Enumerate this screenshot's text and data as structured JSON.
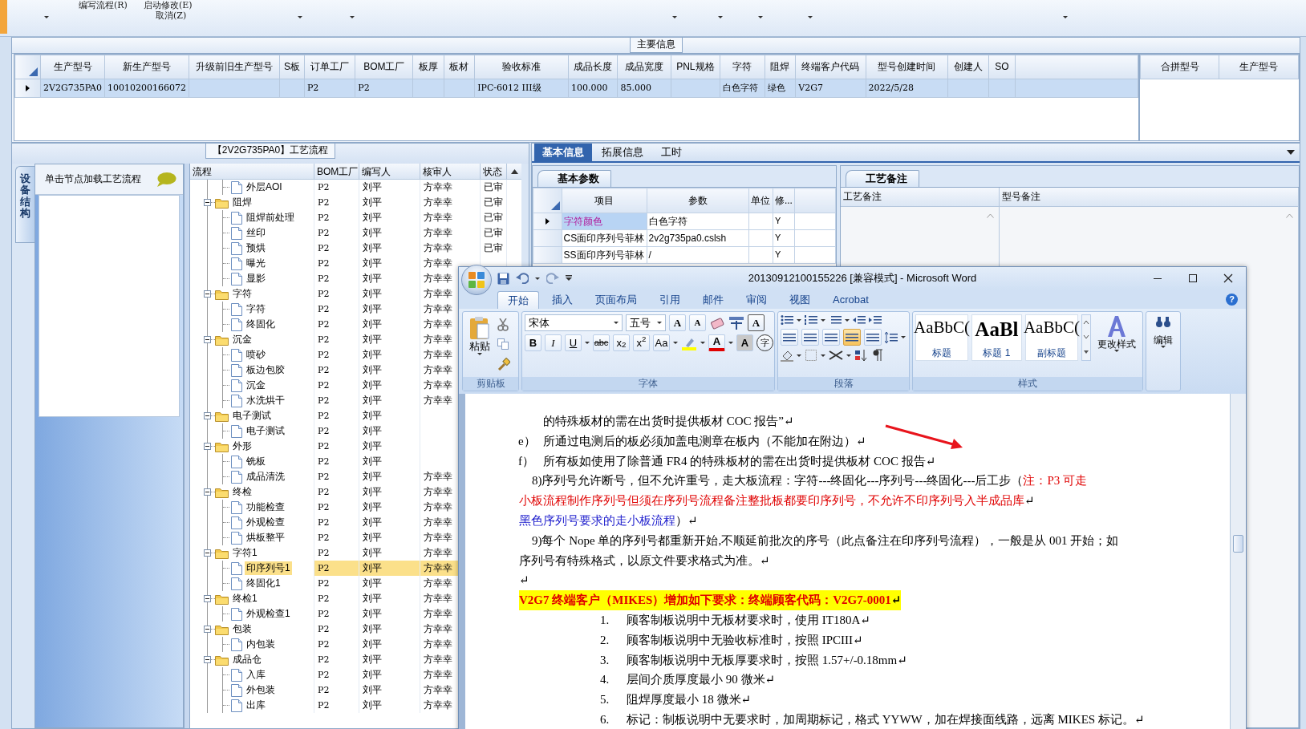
{
  "toolbar": {
    "menu_items": [
      {
        "label": "编写流程(R)"
      },
      {
        "label": "启动修改(E)"
      },
      {
        "label": "取消(Z)"
      }
    ]
  },
  "main_info": {
    "title": "主要信息",
    "row_selected": true,
    "columns": [
      {
        "label": "生产型号",
        "value": "2V2G735PA0"
      },
      {
        "label": "新生产型号",
        "value": "10010200166072"
      },
      {
        "label": "升级前旧生产型号"
      },
      {
        "label": "S板"
      },
      {
        "label": "订单工厂",
        "value": "P2"
      },
      {
        "label": "BOM工厂",
        "value": "P2"
      },
      {
        "label": "板厚"
      },
      {
        "label": "板材"
      },
      {
        "label": "验收标准",
        "value": "IPC-6012 III级"
      },
      {
        "label": "成品长度",
        "value": "100.000"
      },
      {
        "label": "成品宽度",
        "value": "85.000"
      },
      {
        "label": "PNL规格"
      },
      {
        "label": "字符",
        "value": "白色字符"
      },
      {
        "label": "阻焊",
        "value": "绿色"
      },
      {
        "label": "终端客户代码",
        "value": "V2G7"
      },
      {
        "label": "型号创建时间",
        "value": "2022/5/28"
      },
      {
        "label": "创建人"
      },
      {
        "label": "SO"
      }
    ],
    "side_columns": [
      "合拼型号",
      "生产型号"
    ]
  },
  "process": {
    "title": "【2V2G735PA0】工艺流程",
    "side_tab": "设备结构",
    "hint": "单击节点加载工艺流程",
    "columns": [
      "流程",
      "BOM工厂",
      "编写人",
      "核审人",
      "状态"
    ],
    "continued_children": [
      {
        "name": "外层AOI",
        "bom": "P2",
        "writer": "刘平",
        "reviewer": "方幸幸",
        "status": "已审",
        "selected": false
      }
    ],
    "nodes": [
      {
        "name": "阻焊",
        "bom": "P2",
        "writer": "刘平",
        "reviewer": "方幸幸",
        "status": "已审",
        "expanded": true,
        "selected": false,
        "children": [
          {
            "name": "阻焊前处理",
            "bom": "P2",
            "writer": "刘平",
            "reviewer": "方幸幸",
            "status": "已审",
            "selected": false
          },
          {
            "name": "丝印",
            "bom": "P2",
            "writer": "刘平",
            "reviewer": "方幸幸",
            "status": "已审",
            "selected": false
          },
          {
            "name": "预烘",
            "bom": "P2",
            "writer": "刘平",
            "reviewer": "方幸幸",
            "status": "已审",
            "selected": false
          },
          {
            "name": "曝光",
            "bom": "P2",
            "writer": "刘平",
            "reviewer": "方幸幸",
            "selected": false
          },
          {
            "name": "显影",
            "bom": "P2",
            "writer": "刘平",
            "reviewer": "方幸幸",
            "selected": false
          }
        ]
      },
      {
        "name": "字符",
        "bom": "P2",
        "writer": "刘平",
        "reviewer": "方幸幸",
        "expanded": true,
        "selected": false,
        "children": [
          {
            "name": "字符",
            "bom": "P2",
            "writer": "刘平",
            "reviewer": "方幸幸",
            "selected": false
          },
          {
            "name": "终固化",
            "bom": "P2",
            "writer": "刘平",
            "reviewer": "方幸幸",
            "selected": false
          }
        ]
      },
      {
        "name": "沉金",
        "bom": "P2",
        "writer": "刘平",
        "reviewer": "方幸幸",
        "expanded": true,
        "selected": false,
        "children": [
          {
            "name": "喷砂",
            "bom": "P2",
            "writer": "刘平",
            "reviewer": "方幸幸",
            "selected": false
          },
          {
            "name": "板边包胶",
            "bom": "P2",
            "writer": "刘平",
            "reviewer": "方幸幸",
            "selected": false
          },
          {
            "name": "沉金",
            "bom": "P2",
            "writer": "刘平",
            "reviewer": "方幸幸",
            "selected": false
          },
          {
            "name": "水洗烘干",
            "bom": "P2",
            "writer": "刘平",
            "reviewer": "方幸幸",
            "selected": false
          }
        ]
      },
      {
        "name": "电子测试",
        "bom": "P2",
        "writer": "刘平",
        "expanded": true,
        "selected": false,
        "children": [
          {
            "name": "电子测试",
            "bom": "P2",
            "writer": "刘平",
            "selected": false
          }
        ]
      },
      {
        "name": "外形",
        "bom": "P2",
        "writer": "刘平",
        "expanded": true,
        "selected": false,
        "children": [
          {
            "name": "铣板",
            "bom": "P2",
            "writer": "刘平",
            "selected": false
          },
          {
            "name": "成品清洗",
            "bom": "P2",
            "writer": "刘平",
            "reviewer": "方幸幸",
            "selected": false
          }
        ]
      },
      {
        "name": "终检",
        "bom": "P2",
        "writer": "刘平",
        "reviewer": "方幸幸",
        "expanded": true,
        "selected": false,
        "children": [
          {
            "name": "功能检查",
            "bom": "P2",
            "writer": "刘平",
            "reviewer": "方幸幸",
            "selected": false
          },
          {
            "name": "外观检查",
            "bom": "P2",
            "writer": "刘平",
            "reviewer": "方幸幸",
            "selected": false
          },
          {
            "name": "烘板整平",
            "bom": "P2",
            "writer": "刘平",
            "reviewer": "方幸幸",
            "selected": false
          }
        ]
      },
      {
        "name": "字符1",
        "bom": "P2",
        "writer": "刘平",
        "reviewer": "方幸幸",
        "expanded": true,
        "selected": false,
        "children": [
          {
            "name": "印序列号1",
            "bom": "P2",
            "writer": "刘平",
            "reviewer": "方幸幸",
            "selected": true
          },
          {
            "name": "终固化1",
            "bom": "P2",
            "writer": "刘平",
            "reviewer": "方幸幸",
            "selected": false
          }
        ]
      },
      {
        "name": "终检1",
        "bom": "P2",
        "writer": "刘平",
        "reviewer": "方幸幸",
        "expanded": true,
        "selected": false,
        "children": [
          {
            "name": "外观检查1",
            "bom": "P2",
            "writer": "刘平",
            "reviewer": "方幸幸",
            "selected": false
          }
        ]
      },
      {
        "name": "包装",
        "bom": "P2",
        "writer": "刘平",
        "reviewer": "方幸幸",
        "expanded": true,
        "selected": false,
        "children": [
          {
            "name": "内包装",
            "bom": "P2",
            "writer": "刘平",
            "reviewer": "方幸幸",
            "selected": false
          }
        ]
      },
      {
        "name": "成品仓",
        "bom": "P2",
        "writer": "刘平",
        "reviewer": "方幸幸",
        "expanded": true,
        "selected": false,
        "children": [
          {
            "name": "入库",
            "bom": "P2",
            "writer": "刘平",
            "reviewer": "方幸幸",
            "selected": false
          },
          {
            "name": "外包装",
            "bom": "P2",
            "writer": "刘平",
            "reviewer": "方幸幸",
            "selected": false
          },
          {
            "name": "出库",
            "bom": "P2",
            "writer": "刘平",
            "reviewer": "方幸幸",
            "selected": false
          }
        ]
      }
    ]
  },
  "detail": {
    "tabs": [
      {
        "label": "基本信息",
        "selected": true
      },
      {
        "label": "拓展信息",
        "selected": false
      },
      {
        "label": "工时",
        "selected": false
      }
    ],
    "params": {
      "tab": "基本参数",
      "columns": [
        "项目",
        "参数",
        "单位",
        "修..."
      ],
      "rows": [
        {
          "item": "字符颜色",
          "value": "白色字符",
          "flag": "Y",
          "selected": true
        },
        {
          "item": "CS面印序列号菲林",
          "value": "2v2g735pa0.cslsh",
          "flag": "Y",
          "selected": false
        },
        {
          "item": "SS面印序列号菲林",
          "value": "/",
          "flag": "Y",
          "selected": false
        }
      ]
    },
    "notes": {
      "tab": "工艺备注",
      "columns": [
        "工艺备注",
        "型号备注"
      ]
    }
  },
  "word": {
    "title": "20130912100155226 [兼容模式] - Microsoft Word",
    "ribbon_tabs": [
      {
        "label": "开始",
        "selected": true
      },
      {
        "label": "插入",
        "selected": false
      },
      {
        "label": "页面布局",
        "selected": false
      },
      {
        "label": "引用",
        "selected": false
      },
      {
        "label": "邮件",
        "selected": false
      },
      {
        "label": "审阅",
        "selected": false
      },
      {
        "label": "视图",
        "selected": false
      },
      {
        "label": "Acrobat",
        "selected": false
      }
    ],
    "help": "?",
    "clipboard": {
      "paste": "粘贴",
      "label": "剪贴板"
    },
    "font": {
      "name": "宋体",
      "size": "五号",
      "grow": "A",
      "shrink": "A",
      "border": "A",
      "bold": "B",
      "italic": "I",
      "underline": "U",
      "strike": "abc",
      "subscript": "x$_{2}$",
      "superscript": "x$^{2}$",
      "case": "Aa",
      "font_color": "A",
      "shading": "A",
      "enclose": "字",
      "label": "字体"
    },
    "paragraph": {
      "alignments": [
        {
          "selected": false
        },
        {
          "selected": false
        },
        {
          "selected": false
        },
        {
          "selected": true
        },
        {
          "selected": false
        }
      ],
      "label": "段落"
    },
    "styles": {
      "items": [
        {
          "preview": "AaBbC(",
          "name": "标题"
        },
        {
          "preview": "AaBl",
          "name": "标题 1"
        },
        {
          "preview": "AaBbC(",
          "name": "副标题"
        }
      ],
      "change": "更改样式",
      "label": "样式"
    },
    "editing": {
      "label": "编辑"
    },
    "lines": [
      {
        "kind": "sub_cont",
        "runs": [
          {
            "text": "的特殊板材的需在出货时提供板材 COC 报告”↵",
            "color": "#000000"
          }
        ]
      },
      {
        "kind": "sub",
        "marker": "e）",
        "runs": [
          {
            "text": "所通过电测后的板必须加盖电测章在板内（不能加在附边）↵",
            "color": "#000000"
          }
        ]
      },
      {
        "kind": "sub",
        "marker": "f）",
        "runs": [
          {
            "text": "所有板如使用了除普通 FR4 的特殊板材的需在出货时提供板材 COC 报告↵",
            "color": "#000000"
          }
        ]
      },
      {
        "kind": "para_first",
        "runs": [
          {
            "text": "8)序列号允许断号，但不允许重号，走大板流程：字符---终固化---序列号---终固化---后工步（",
            "color": "#000000"
          },
          {
            "text": "注：P3 可走",
            "color": "#e00000"
          }
        ]
      },
      {
        "kind": "para_cont",
        "runs": [
          {
            "text": "小板流程制作序列号但须在序列号流程备注整批板都要印序列号，不允许不印序列号入半成品库",
            "color": "#e00000"
          },
          {
            "text": "↵",
            "color": "#000000"
          }
        ]
      },
      {
        "kind": "para_cont",
        "runs": [
          {
            "text": "黑色序列号要求的走小板流程",
            "color": "#1a1acc"
          },
          {
            "text": "）↵",
            "color": "#000000"
          }
        ]
      },
      {
        "kind": "para_first",
        "runs": [
          {
            "text": "9)每个 Nope 单的序列号都重新开始,不顺延前批次的序号（此点备注在印序列号流程），一般是从 001 开始；如",
            "color": "#000000"
          }
        ]
      },
      {
        "kind": "para_cont",
        "runs": [
          {
            "text": "序列号有特殊格式，以原文件要求格式为准。↵",
            "color": "#000000"
          }
        ]
      },
      {
        "kind": "blank",
        "runs": [
          {
            "text": "↵",
            "color": "#000000"
          }
        ]
      },
      {
        "kind": "heading",
        "runs": [
          {
            "text": "V2G7 终端客户（MIKES）增加如下要求：终端顾客代码：V2G7-0001",
            "color": "#e00000"
          },
          {
            "text": "↵",
            "color": "#000000"
          }
        ]
      },
      {
        "kind": "numbered",
        "marker": "1.",
        "runs": [
          {
            "text": "顾客制板说明中无板材要求时，使用 IT180A↵",
            "color": "#000000"
          }
        ]
      },
      {
        "kind": "numbered",
        "marker": "2.",
        "runs": [
          {
            "text": "顾客制板说明中无验收标准时，按照 IPCIII↵",
            "color": "#000000"
          }
        ]
      },
      {
        "kind": "numbered",
        "marker": "3.",
        "runs": [
          {
            "text": "顾客制板说明中无板厚要求时，按照 1.57+/-0.18mm↵",
            "color": "#000000"
          }
        ]
      },
      {
        "kind": "numbered",
        "marker": "4.",
        "runs": [
          {
            "text": "层间介质厚度最小 90 微米↵",
            "color": "#000000"
          }
        ]
      },
      {
        "kind": "numbered",
        "marker": "5.",
        "runs": [
          {
            "text": "阻焊厚度最小 18 微米↵",
            "color": "#000000"
          }
        ]
      },
      {
        "kind": "numbered",
        "marker": "6.",
        "runs": [
          {
            "text": "标记：制板说明中无要求时，加周期标记，格式 YYWW，加在焊接面线路，远离 MIKES 标记。↵",
            "color": "#000000"
          }
        ]
      }
    ]
  }
}
